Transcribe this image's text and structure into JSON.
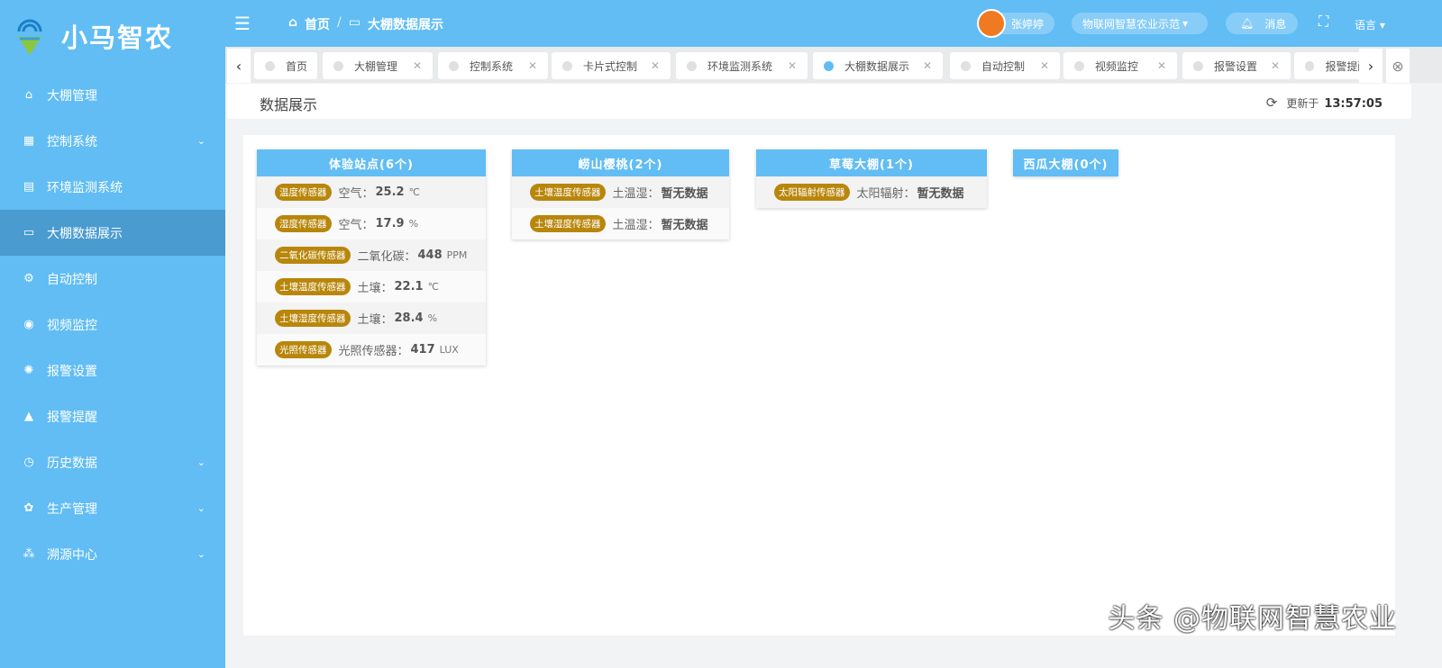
{
  "app": {
    "title": "小马智农"
  },
  "sidebar": {
    "items": [
      {
        "label": "大棚管理",
        "icon": "home-icon"
      },
      {
        "label": "控制系统",
        "icon": "grid-icon",
        "expandable": true
      },
      {
        "label": "环境监测系统",
        "icon": "monitor-chart-icon"
      },
      {
        "label": "大棚数据展示",
        "icon": "display-icon",
        "active": true
      },
      {
        "label": "自动控制",
        "icon": "auto-icon"
      },
      {
        "label": "视频监控",
        "icon": "camera-icon"
      },
      {
        "label": "报警设置",
        "icon": "alarm-icon"
      },
      {
        "label": "报警提醒",
        "icon": "warning-icon"
      },
      {
        "label": "历史数据",
        "icon": "history-icon",
        "expandable": true
      },
      {
        "label": "生产管理",
        "icon": "production-icon",
        "expandable": true
      },
      {
        "label": "溯源中心",
        "icon": "trace-icon",
        "expandable": true
      }
    ]
  },
  "header": {
    "breadcrumb": [
      "首页",
      "大棚数据展示"
    ],
    "user": "张婷婷",
    "project": "物联网智慧农业示范",
    "messages": "消息",
    "language": "语言"
  },
  "tabs": [
    {
      "label": "首页",
      "closable": false
    },
    {
      "label": "大棚管理"
    },
    {
      "label": "控制系统"
    },
    {
      "label": "卡片式控制"
    },
    {
      "label": "环境监测系统"
    },
    {
      "label": "大棚数据展示",
      "active": true
    },
    {
      "label": "自动控制"
    },
    {
      "label": "视频监控"
    },
    {
      "label": "报警设置"
    },
    {
      "label": "报警提醒"
    }
  ],
  "page": {
    "title": "数据展示",
    "updated_label": "更新于",
    "updated_time": "13:57:05"
  },
  "colors": {
    "primary": "#61bdf4",
    "badge": "#b8860b",
    "active_nav": "#4a9bd0"
  },
  "cards": [
    {
      "title": "体验站点(6个)",
      "rows": [
        {
          "badge": "温度传感器",
          "label": "空气：",
          "value": "25.2",
          "unit": "℃"
        },
        {
          "badge": "湿度传感器",
          "label": "空气：",
          "value": "17.9",
          "unit": "%"
        },
        {
          "badge": "二氧化碳传感器",
          "label": "二氧化碳：",
          "value": "448",
          "unit": "PPM"
        },
        {
          "badge": "土壤温度传感器",
          "label": "土壤：",
          "value": "22.1",
          "unit": "℃"
        },
        {
          "badge": "土壤湿度传感器",
          "label": "土壤：",
          "value": "28.4",
          "unit": "%"
        },
        {
          "badge": "光照传感器",
          "label": "光照传感器：",
          "value": "417",
          "unit": "LUX"
        }
      ]
    },
    {
      "title": "崂山樱桃(2个)",
      "rows": [
        {
          "badge": "土壤温度传感器",
          "label": "土温湿：",
          "value": "暂无数据",
          "unit": ""
        },
        {
          "badge": "土壤湿度传感器",
          "label": "土温湿：",
          "value": "暂无数据",
          "unit": ""
        }
      ]
    },
    {
      "title": "草莓大棚(1个)",
      "rows": [
        {
          "badge": "太阳辐射传感器",
          "label": "太阳辐射：",
          "value": "暂无数据",
          "unit": ""
        }
      ]
    },
    {
      "title": "西瓜大棚(0个)",
      "rows": []
    }
  ],
  "watermark": "头条 @物联网智慧农业"
}
